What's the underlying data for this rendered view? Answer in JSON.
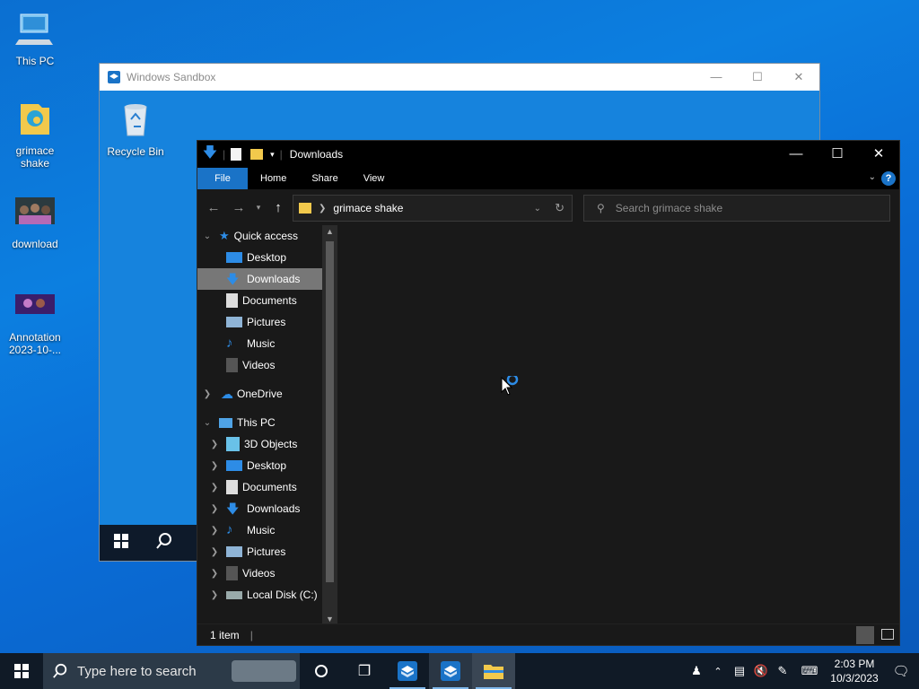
{
  "desktop": {
    "icons": [
      {
        "label_line1": "This PC",
        "label_line2": ""
      },
      {
        "label_line1": "grimace",
        "label_line2": "shake"
      },
      {
        "label_line1": "download",
        "label_line2": ""
      },
      {
        "label_line1": "Annotation",
        "label_line2": "2023-10-..."
      }
    ]
  },
  "sandbox": {
    "title": "Windows Sandbox",
    "recycle_bin_label": "Recycle Bin"
  },
  "explorer": {
    "title": "Downloads",
    "ribbon_tabs": [
      "File",
      "Home",
      "Share",
      "View"
    ],
    "address_path": "grimace shake",
    "search_placeholder": "Search grimace shake",
    "quick_access": "Quick access",
    "quick_items": [
      "Desktop",
      "Downloads",
      "Documents",
      "Pictures",
      "Music",
      "Videos"
    ],
    "onedrive": "OneDrive",
    "this_pc": "This PC",
    "pc_items": [
      "3D Objects",
      "Desktop",
      "Documents",
      "Downloads",
      "Music",
      "Pictures",
      "Videos",
      "Local Disk (C:)"
    ],
    "status_count": "1 item"
  },
  "taskbar": {
    "search_placeholder": "Type here to search",
    "time": "2:03 PM",
    "date": "10/3/2023"
  },
  "colors": {
    "accent": "#1a73c7",
    "desktop_bg": "#0b6fd1",
    "explorer_bg": "#191919",
    "selected": "#777777"
  }
}
